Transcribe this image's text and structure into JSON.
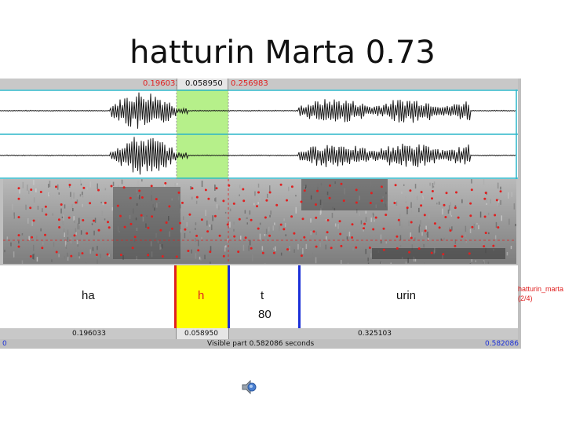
{
  "slide": {
    "title": "hatturin Marta 0.73"
  },
  "editor": {
    "top_bar": {
      "left_duration": "0.196033",
      "selection_duration": "0.058950",
      "right_duration": "0.256983"
    },
    "tier": {
      "intervals": [
        {
          "label": "ha"
        },
        {
          "label": "h"
        },
        {
          "label": "t",
          "value": "80"
        },
        {
          "label": "urin"
        }
      ],
      "side_label_line1": "hatturin_marta",
      "side_label_line2": "(2/4)"
    },
    "bottom_bar": {
      "left_duration": "0.196033",
      "selection_duration": "0.058950",
      "right_duration": "0.325103"
    },
    "status": {
      "start_time": "0",
      "visible_part": "Visible part 0.582086 seconds",
      "end_time": "0.582086"
    },
    "colors": {
      "selection": "#b6f08a",
      "boundary_red": "#e02020",
      "boundary_blue": "#1b2fd8",
      "highlight_yellow": "#ffff00",
      "cursor_line": "#2bb5c8"
    }
  },
  "icons": {
    "speaker": "speaker-icon"
  }
}
